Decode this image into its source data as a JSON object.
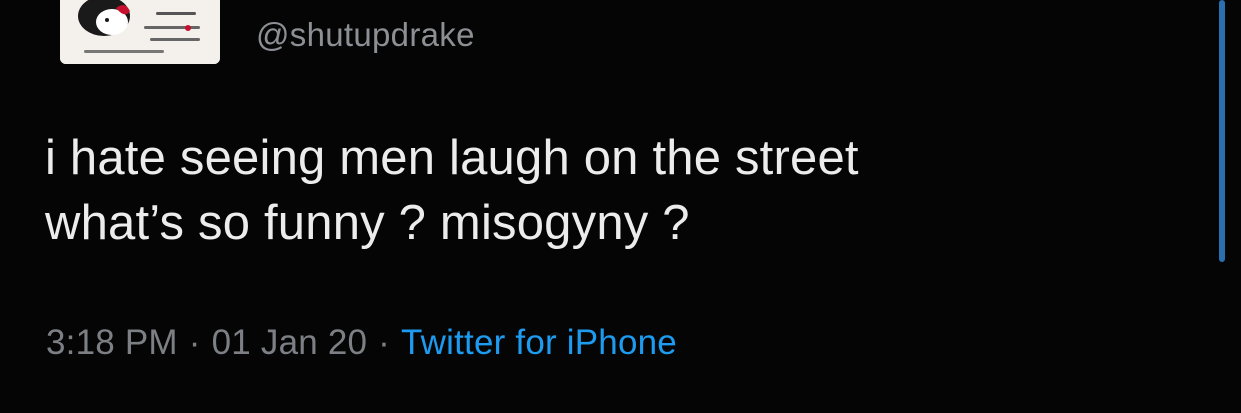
{
  "colors": {
    "background": "#050505",
    "text": "#ececec",
    "muted": "#7c8085",
    "link": "#1d9bf0",
    "scrollbar": "#2a6fb0"
  },
  "tweet": {
    "handle": "@shutupdrake",
    "lines": [
      "i hate seeing men laugh on the street",
      "what’s so funny ? misogyny ?"
    ],
    "time": "3:18 PM",
    "separator": "·",
    "date": "01 Jan 20",
    "source": "Twitter for iPhone"
  }
}
